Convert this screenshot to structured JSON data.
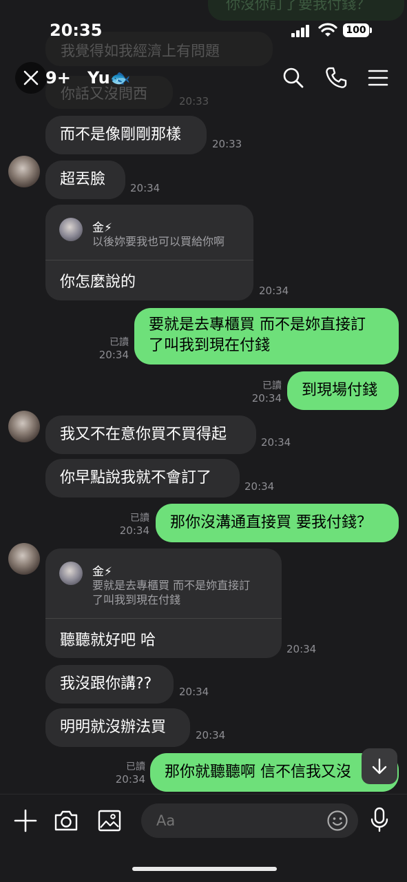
{
  "status_bar": {
    "time": "20:35",
    "battery": "100"
  },
  "header": {
    "unread_count": "9+",
    "title": "Yu🐟"
  },
  "background_ghost": {
    "top_bubble": "你沒你訂了要我付錢？",
    "line1": "我覺得如我經濟上有問題",
    "line2": "你話又沒問西",
    "time": "20:33"
  },
  "messages": [
    {
      "text": "而不是像剛剛那樣",
      "time": "20:33"
    },
    {
      "text": "超丟臉",
      "time": "20:34"
    },
    {
      "reply_name": "金⚡",
      "reply_quote": "以後妳要我也可以買給你啊",
      "text": "你怎麼說的",
      "time": "20:34"
    },
    {
      "line1": "要就是去專櫃買 而不是妳直接訂",
      "line2": "了叫我到現在付錢",
      "read": "已讀",
      "time": "20:34"
    },
    {
      "text": "到現場付錢",
      "read": "已讀",
      "time": "20:34"
    },
    {
      "text": "我又不在意你買不買得起",
      "time": "20:34"
    },
    {
      "text": "你早點說我就不會訂了",
      "time": "20:34"
    },
    {
      "text": "那你沒溝通直接買 要我付錢？",
      "read": "已讀",
      "time": "20:34"
    },
    {
      "reply_name": "金⚡",
      "reply_quote1": "要就是去專櫃買 而不是妳直接訂",
      "reply_quote2": "了叫我到現在付錢",
      "text": "聽聽就好吧 哈",
      "time": "20:34"
    },
    {
      "text": "我沒跟你講??",
      "time": "20:34"
    },
    {
      "text": "明明就沒辦法買",
      "time": "20:34"
    },
    {
      "text": "那你就聽聽啊 信不信我又沒",
      "read": "已讀",
      "time": "20:34"
    }
  ],
  "composer": {
    "placeholder": "Aa"
  },
  "colors": {
    "background": "#1b1b1d",
    "incoming": "#2d2d2f",
    "outgoing": "#6ee07a",
    "meta": "#8e8e93"
  }
}
